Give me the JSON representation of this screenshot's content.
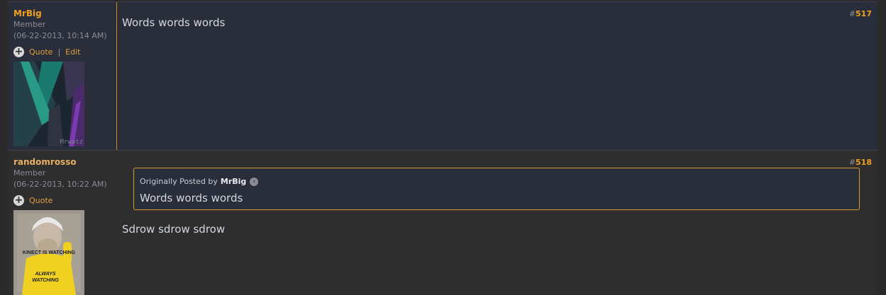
{
  "posts": [
    {
      "username": "MrBig",
      "rank": "Member",
      "date": "(06-22-2013, 10:14 AM)",
      "actions": {
        "quote": "Quote",
        "separator": "|",
        "edit": "Edit"
      },
      "avatar_watermark": "Mrwatz",
      "number_prefix": "#",
      "number": "517",
      "message": "Words words words"
    },
    {
      "username": "randomrosso",
      "rank": "Member",
      "date": "(06-22-2013, 10:22 AM)",
      "actions": {
        "quote": "Quote"
      },
      "avatar_text": {
        "line1": "KINECT IS WATCHING",
        "line2": "ALWAYS",
        "line3": "WATCHING"
      },
      "number_prefix": "#",
      "number": "518",
      "quote": {
        "prefix": "Originally Posted by",
        "author": "MrBig",
        "text": "Words words words"
      },
      "message": "Sdrow sdrow sdrow"
    }
  ],
  "colors": {
    "accent": "#f0a020",
    "text": "#d4d7de",
    "muted": "#8a8d94"
  },
  "icons": [
    "plus-icon",
    "view-post-icon"
  ]
}
